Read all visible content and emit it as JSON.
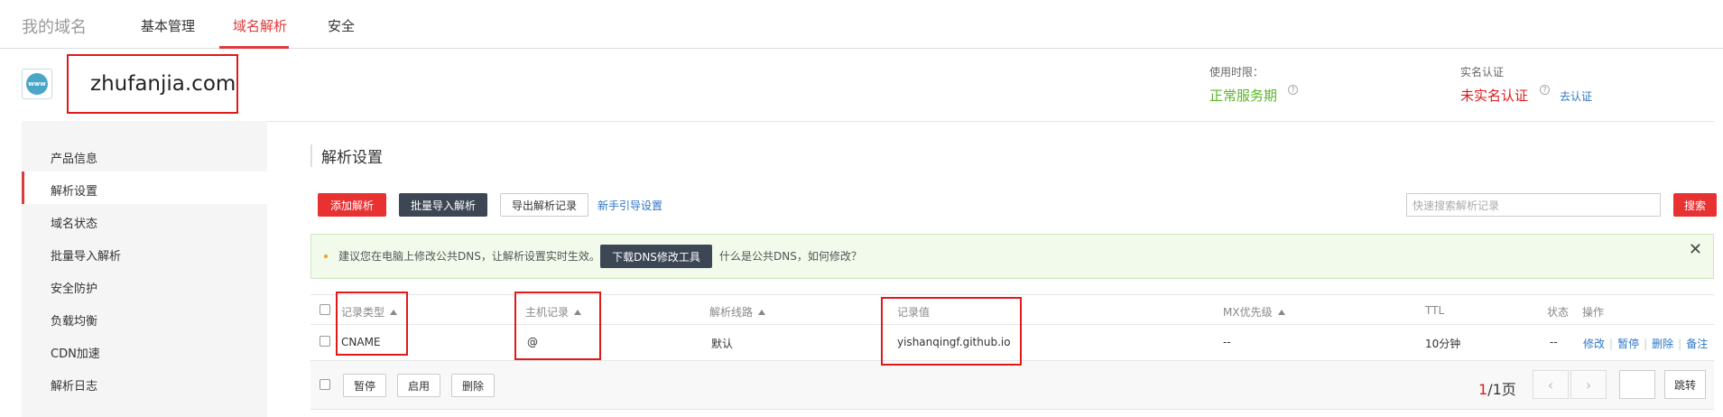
{
  "topnav": {
    "brand": "我的域名",
    "tabs": [
      "基本管理",
      "域名解析",
      "安全"
    ],
    "active_tab": "域名解析"
  },
  "domain": {
    "icon_text": "www",
    "name": "zhufanjia.com",
    "service_label": "使用时限：",
    "service_status": "正常服务期",
    "realname_label": "实名认证",
    "realname_status": "未实名认证",
    "realname_link": "去认证"
  },
  "sidebar": {
    "items": [
      {
        "label": "产品信息"
      },
      {
        "label": "解析设置"
      },
      {
        "label": "域名状态"
      },
      {
        "label": "批量导入解析"
      },
      {
        "label": "安全防护"
      },
      {
        "label": "负载均衡"
      },
      {
        "label": "CDN加速"
      },
      {
        "label": "解析日志"
      }
    ],
    "active": "解析设置"
  },
  "main": {
    "title": "解析设置",
    "buttons": {
      "add": "添加解析",
      "import": "批量导入解析",
      "export": "导出解析记录",
      "guide": "新手引导设置"
    },
    "search": {
      "placeholder": "快速搜索解析记录",
      "button": "搜索"
    },
    "notice": {
      "text": "建议您在电脑上修改公共DNS，让解析设置实时生效。",
      "download_button": "下载DNS修改工具",
      "link": "什么是公共DNS，如何修改？",
      "close": "✕"
    },
    "table": {
      "columns": [
        "记录类型",
        "主机记录",
        "解析线路",
        "记录值",
        "MX优先级",
        "TTL",
        "状态",
        "操作"
      ],
      "rows": [
        {
          "type": "CNAME",
          "host": "@",
          "line": "默认",
          "value": "yishanqingf.github.io",
          "mx": "--",
          "ttl": "10分钟",
          "status": "--",
          "ops": [
            "修改",
            "暂停",
            "删除",
            "备注"
          ]
        }
      ],
      "footer_buttons": [
        "暂停",
        "启用",
        "删除"
      ]
    },
    "pager": {
      "current": "1",
      "total": "/1页",
      "prev": "‹",
      "next": "›",
      "go": "跳转"
    }
  },
  "colors": {
    "accent": "#e0393b",
    "green": "#59b526",
    "link": "#2d76c5",
    "dark_button": "#3c4654"
  }
}
